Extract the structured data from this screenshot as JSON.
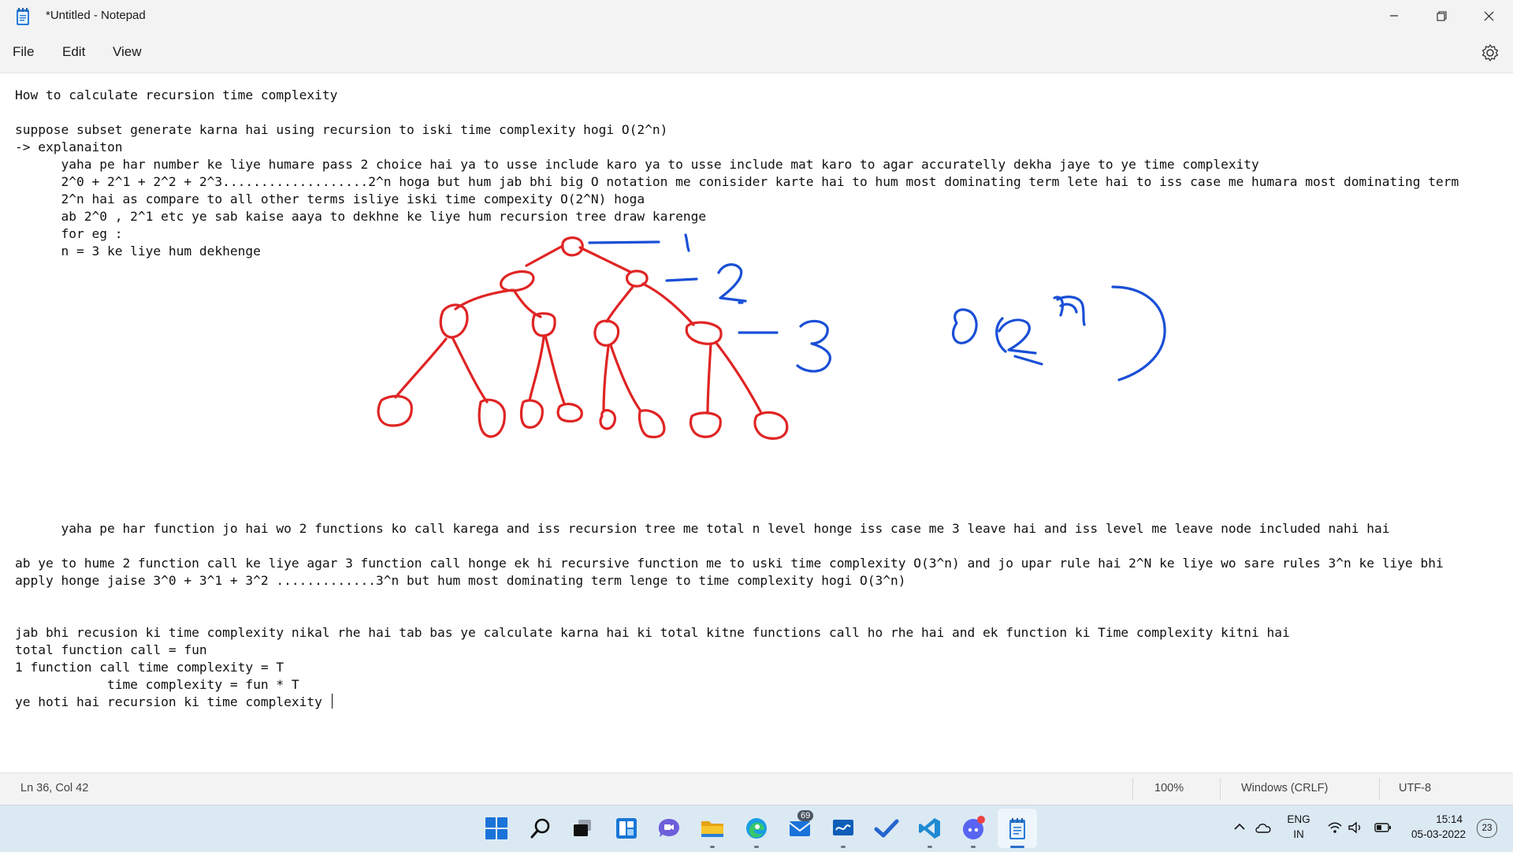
{
  "window": {
    "title": "*Untitled - Notepad",
    "app_icon": "notepad-icon",
    "controls": [
      "minimize-icon",
      "maximize-icon",
      "close-icon"
    ]
  },
  "menu": {
    "file": "File",
    "edit": "Edit",
    "view": "View",
    "settings_icon": "gear-icon"
  },
  "editor": {
    "lines": [
      "How to calculate recursion time complexity",
      "",
      "suppose subset generate karna hai using recursion to iski time complexity hogi O(2^n)",
      "-> explanaiton",
      "      yaha pe har number ke liye humare pass 2 choice hai ya to usse include karo ya to usse include mat karo to agar accuratelly dekha jaye to ye time complexity",
      "      2^0 + 2^1 + 2^2 + 2^3...................2^n hoga but hum jab bhi big O notation me conisider karte hai to hum most dominating term lete hai to iss case me humara most dominating term",
      "      2^n hai as compare to all other terms isliye iski time compexity O(2^N) hoga",
      "      ab 2^0 , 2^1 etc ye sab kaise aaya to dekhne ke liye hum recursion tree draw karenge",
      "      for eg :",
      "      n = 3 ke liye hum dekhenge",
      "      yaha pe har function jo hai wo 2 functions ko call karega and iss recursion tree me total n level honge iss case me 3 leave hai and iss level me leave node included nahi hai",
      "ab ye to hume 2 function call ke liye agar 3 function call honge ek hi recursive function me to uski time complexity O(3^n) and jo upar rule hai 2^N ke liye wo sare rules 3^n ke liye bhi",
      "apply honge jaise 3^0 + 3^1 + 3^2 .............3^n but hum most dominating term lenge to time complexity hogi O(3^n)",
      "jab bhi recusion ki time complexity nikal rhe hai tab bas ye calculate karna hai ki total kitne functions call ho rhe hai and ek function ki Time complexity kitni hai",
      "total function call = fun",
      "1 function call time complexity = T",
      "            time complexity = fun * T",
      "ye hoti hai recursion ki time complexity "
    ],
    "drawing": {
      "description_colors": {
        "tree": "#e02424",
        "annotations": "#1a4fd6"
      },
      "level_labels": [
        "1",
        "2",
        "3"
      ],
      "complexity_label": "O(2^n)"
    }
  },
  "status": {
    "position": "Ln 36, Col 42",
    "zoom": "100%",
    "line_ending": "Windows (CRLF)",
    "encoding": "UTF-8"
  },
  "taskbar": {
    "apps": [
      "windows-start-icon",
      "search-icon",
      "task-view-icon",
      "widgets-icon",
      "chat-icon",
      "file-explorer-icon",
      "edge-icon",
      "mail-icon",
      "whiteboard-icon",
      "todo-icon",
      "vscode-icon",
      "discord-icon",
      "notepad-icon"
    ],
    "mail_badge": "69",
    "tray": {
      "language_top": "ENG",
      "language_bottom": "IN",
      "time": "15:14",
      "date": "05-03-2022",
      "notifications": "23"
    }
  }
}
